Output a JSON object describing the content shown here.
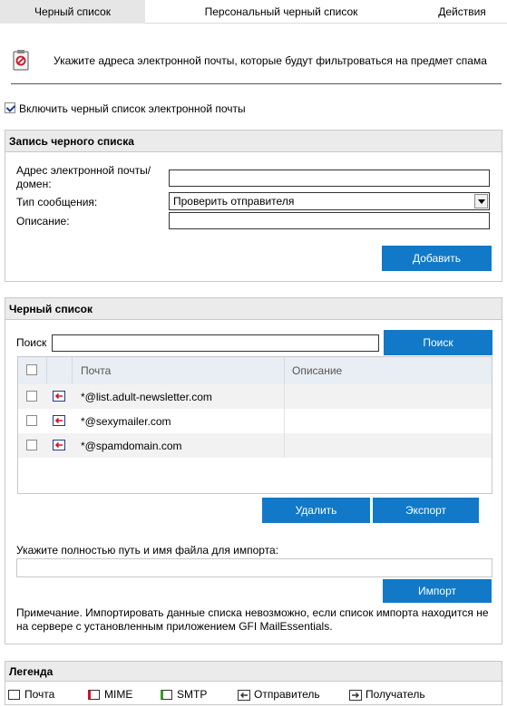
{
  "tabs": [
    {
      "label": "Черный список",
      "active": true
    },
    {
      "label": "Персональный черный список",
      "active": false
    },
    {
      "label": "Действия",
      "active": false
    }
  ],
  "intro": {
    "text": "Укажите адреса электронной почты, которые будут фильтроваться на предмет спама",
    "icon": "blacklist-clipboard-icon"
  },
  "enable": {
    "label": "Включить черный список электронной почты",
    "checked": true
  },
  "entry": {
    "title": "Запись черного списка",
    "email_label": "Адрес электронной почты/домен:",
    "email_value": "",
    "type_label": "Тип сообщения:",
    "type_value": "Проверить отправителя",
    "desc_label": "Описание:",
    "desc_value": "",
    "add_button": "Добавить"
  },
  "blacklist": {
    "title": "Черный список",
    "search_label": "Поиск",
    "search_value": "",
    "search_button": "Поиск",
    "columns": {
      "email": "Почта",
      "description": "Описание"
    },
    "rows": [
      {
        "email": "*@list.adult-newsletter.com",
        "description": "",
        "type": "sender"
      },
      {
        "email": "*@sexymailer.com",
        "description": "",
        "type": "sender"
      },
      {
        "email": "*@spamdomain.com",
        "description": "",
        "type": "sender"
      }
    ],
    "delete_button": "Удалить",
    "export_button": "Экспорт",
    "import_label": "Укажите полностью путь и имя файла для импорта:",
    "import_value": "",
    "import_button": "Импорт",
    "note": "Примечание. Импортировать данные списка невозможно, если список импорта находится не на сервере с установленным приложением GFI MailEssentials."
  },
  "legend": {
    "title": "Легенда",
    "items": [
      {
        "label": "Почта",
        "icon": "mail-legend-icon"
      },
      {
        "label": "MIME",
        "icon": "mime-legend-icon"
      },
      {
        "label": "SMTP",
        "icon": "smtp-legend-icon"
      },
      {
        "label": "Отправитель",
        "icon": "sender-legend-icon"
      },
      {
        "label": "Получатель",
        "icon": "recipient-legend-icon"
      }
    ]
  },
  "colors": {
    "button": "#1179c7",
    "section_header": "#ebebeb",
    "active_tab": "#e6e6e6"
  }
}
